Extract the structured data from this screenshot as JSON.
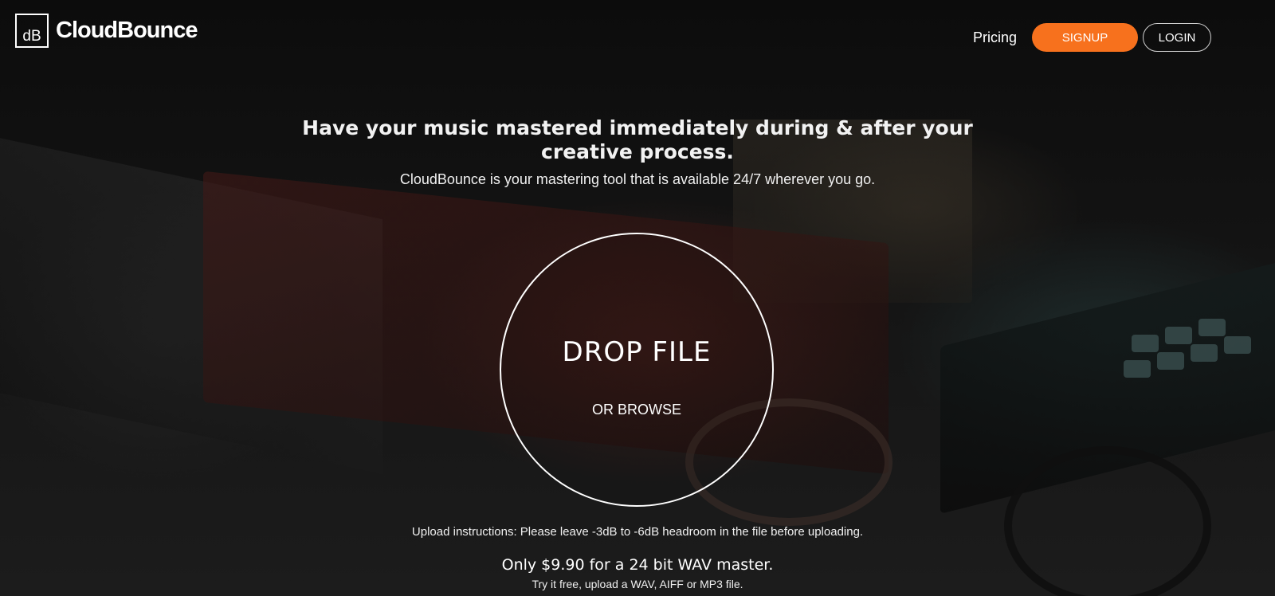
{
  "header": {
    "logo_mark": "dB",
    "logo_text": "CloudBounce",
    "nav": {
      "pricing": "Pricing",
      "signup": "SIGNUP",
      "login": "LOGIN"
    }
  },
  "hero": {
    "headline": "Have your music mastered immediately during & after your creative process.",
    "subline": "CloudBounce is your mastering tool that is available 24/7 wherever you go.",
    "dropzone": {
      "title": "DROP FILE",
      "browse": "OR BROWSE"
    },
    "upload_note": "Upload instructions: Please leave -3dB to -6dB headroom in the file before uploading.",
    "price_line": "Only $9.90 for a 24 bit WAV master.",
    "try_line": "Try it free, upload a WAV, AIFF or MP3 file."
  },
  "colors": {
    "accent": "#f7711d",
    "background": "#111111",
    "text": "#ffffff"
  }
}
